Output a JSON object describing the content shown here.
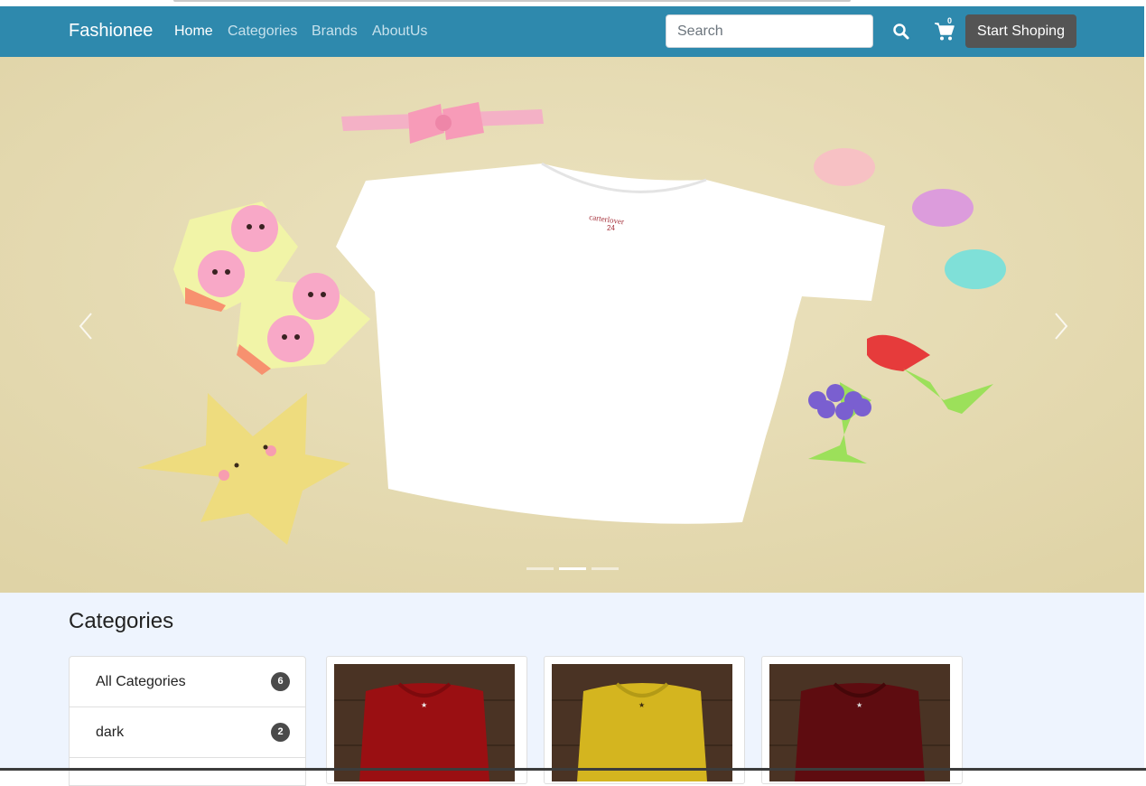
{
  "navbar": {
    "brand": "Fashionee",
    "links": [
      "Home",
      "Categories",
      "Brands",
      "AboutUs"
    ],
    "active_link": "Home",
    "search_placeholder": "Search",
    "search_icon": "search-icon",
    "cart_icon": "shopping-cart-icon",
    "cart_count": "0",
    "cta_label": "Start Shoping",
    "color": "#2e89ad"
  },
  "carousel": {
    "slide_count": 3,
    "active_slide_index": 1,
    "prev_icon": "chevron-left-icon",
    "next_icon": "chevron-right-icon",
    "background_color": "#e6dcb6"
  },
  "categories": {
    "title": "Categories",
    "items": [
      {
        "label": "All Categories",
        "count": "6"
      },
      {
        "label": "dark",
        "count": "2"
      }
    ],
    "products": [
      {
        "color_name": "red t-shirt",
        "color": "#9a0f12"
      },
      {
        "color_name": "yellow t-shirt",
        "color": "#d4b51f"
      },
      {
        "color_name": "maroon t-shirt",
        "color": "#5e0c10"
      }
    ]
  }
}
